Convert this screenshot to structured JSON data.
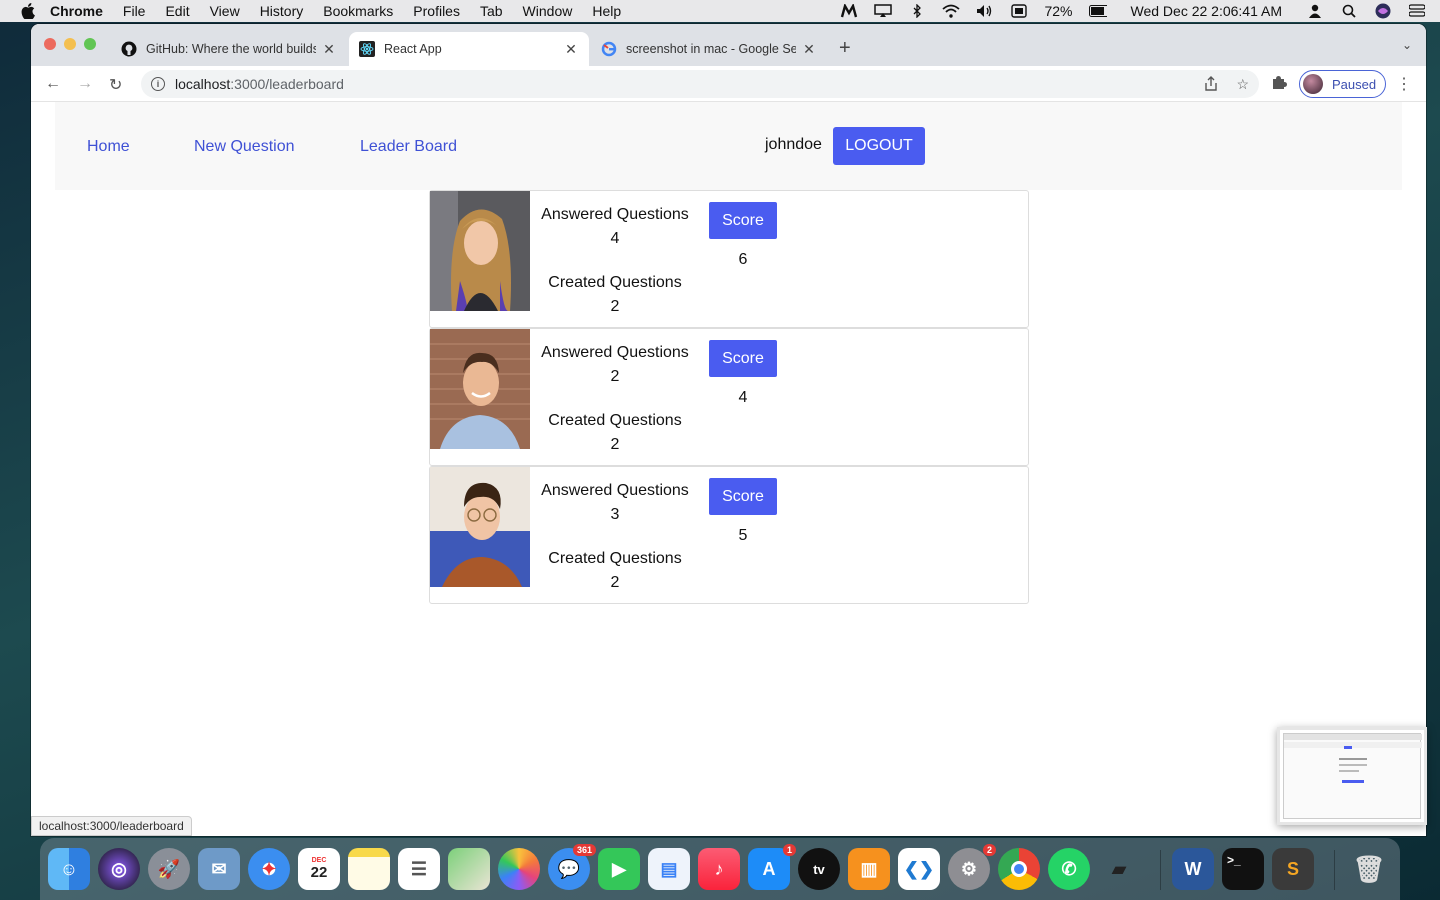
{
  "menubar": {
    "app_name": "Chrome",
    "items": [
      "File",
      "Edit",
      "View",
      "History",
      "Bookmarks",
      "Profiles",
      "Tab",
      "Window",
      "Help"
    ],
    "battery": "72%",
    "datetime": "Wed Dec 22  2:06:41 AM"
  },
  "browser": {
    "tabs": [
      {
        "title": "GitHub: Where the world builds"
      },
      {
        "title": "React App"
      },
      {
        "title": "screenshot in mac - Google Search"
      }
    ],
    "address": {
      "host": "localhost",
      "path": ":3000/leaderboard"
    },
    "profile_label": "Paused",
    "status_url": "localhost:3000/leaderboard"
  },
  "app": {
    "nav": {
      "home": "Home",
      "new_question": "New Question",
      "leader_board": "Leader Board"
    },
    "username": "johndoe",
    "logout": "LOGOUT",
    "labels": {
      "answered": "Answered Questions",
      "created": "Created Questions",
      "score": "Score"
    },
    "leaders": [
      {
        "answered": "4",
        "created": "2",
        "score": "6",
        "avatar": "woman-avatar"
      },
      {
        "answered": "2",
        "created": "2",
        "score": "4",
        "avatar": "man-avatar"
      },
      {
        "answered": "3",
        "created": "2",
        "score": "5",
        "avatar": "man-glasses-avatar"
      }
    ]
  },
  "dock": {
    "badges": {
      "messages": "361",
      "appstore": "1",
      "settings": "2"
    },
    "calendar_month": "DEC",
    "calendar_day": "22"
  }
}
